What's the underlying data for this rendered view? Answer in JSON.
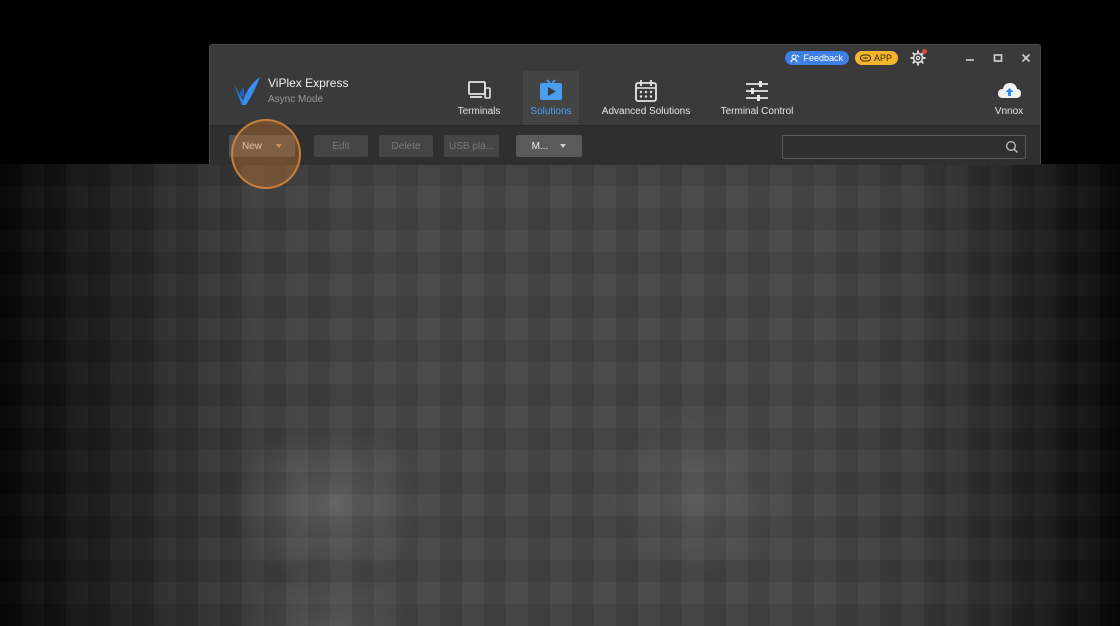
{
  "app": {
    "name": "ViPlex Express",
    "mode": "Async Mode"
  },
  "top_right": {
    "feedback_label": "Feedback",
    "app_label": "APP"
  },
  "nav": [
    {
      "label": "Terminals",
      "icon": "monitor-icon",
      "active": false
    },
    {
      "label": "Solutions",
      "icon": "play-tv-icon",
      "active": true
    },
    {
      "label": "Advanced Solutions",
      "icon": "calendar-icon",
      "active": false
    },
    {
      "label": "Terminal Control",
      "icon": "sliders-icon",
      "active": false
    }
  ],
  "vnnox": {
    "label": "Vnnox",
    "icon": "cloud-upload-icon"
  },
  "toolbar": {
    "new_label": "New",
    "edit_label": "Edit",
    "delete_label": "Delete",
    "usb_label": "USB pla...",
    "more_label": "M..."
  },
  "search": {
    "value": "",
    "placeholder": ""
  },
  "colors": {
    "accent": "#4a9ef0",
    "feedback_bg": "#3e7fe3",
    "app_bg": "#f2b52e",
    "notification_dot": "#e0453a",
    "click_highlight": "#d7873c"
  }
}
